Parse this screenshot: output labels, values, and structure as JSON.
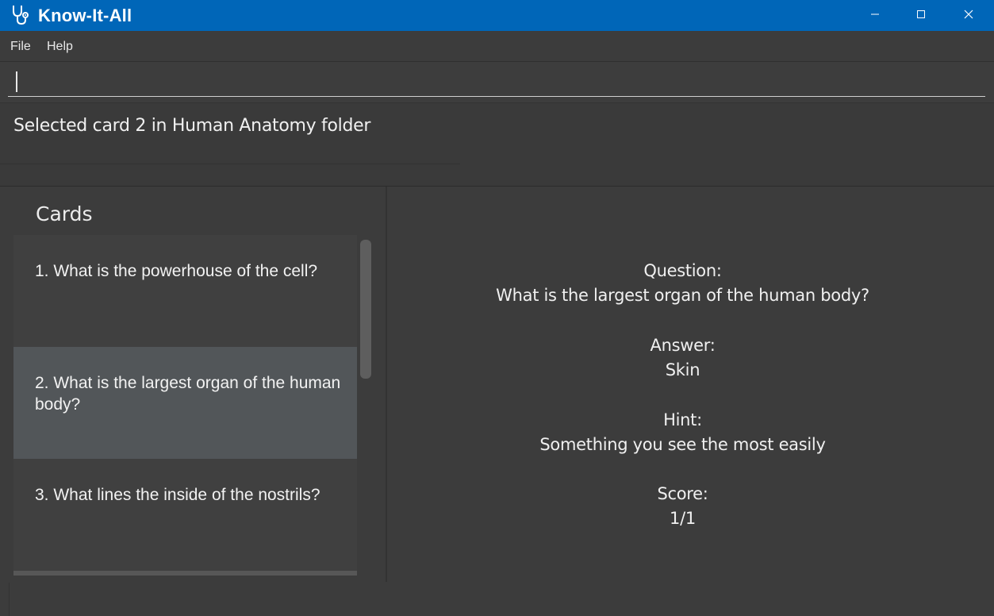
{
  "window": {
    "title": "Know-It-All",
    "app_icon": "stethoscope-icon",
    "controls": {
      "minimize_icon": "minimize-icon",
      "maximize_icon": "maximize-icon",
      "close_icon": "close-icon"
    },
    "title_bar_color": "#0066b8"
  },
  "menu": {
    "file": "File",
    "help": "Help"
  },
  "command": {
    "value": "",
    "placeholder": ""
  },
  "result": {
    "message": "Selected card 2 in Human Anatomy folder"
  },
  "cards_panel": {
    "title": "Cards",
    "items": [
      {
        "label": "1. What is the powerhouse of the cell?"
      },
      {
        "label": "2. What is the largest organ of the human body?"
      },
      {
        "label": "3. What lines the inside of the nostrils?"
      }
    ],
    "selected_index": 2
  },
  "card_detail": {
    "question_label": "Question:",
    "question": "What is the largest organ of the human body?",
    "answer_label": "Answer:",
    "answer": "Skin",
    "hint_label": "Hint:",
    "hint": "Something you see the most easily",
    "score_label": "Score:",
    "score": "1/1"
  }
}
